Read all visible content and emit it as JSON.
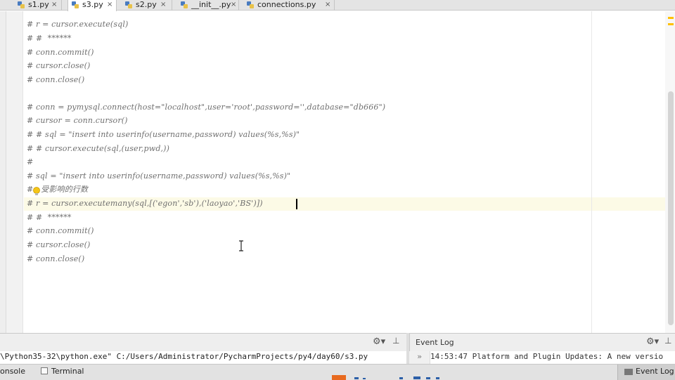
{
  "tabs": [
    {
      "label": "s1.py",
      "active": false
    },
    {
      "label": "s3.py",
      "active": true
    },
    {
      "label": "s2.py",
      "active": false
    },
    {
      "label": "__init__.py",
      "active": false
    },
    {
      "label": "connections.py",
      "active": false
    }
  ],
  "tab_close_glyph": "×",
  "code_lines": [
    "# r = cursor.execute(sql)",
    "# #  ******",
    "# conn.commit()",
    "# cursor.close()",
    "# conn.close()",
    "",
    "# conn = pymysql.connect(host=\"localhost\",user='root',password='',database=\"db666\")",
    "# cursor = conn.cursor()",
    "# # sql = \"insert into userinfo(username,password) values(%s,%s)\"",
    "# # cursor.execute(sql,(user,pwd,))",
    "#",
    "# sql = \"insert into userinfo(username,password) values(%s,%s)\"",
    "#   受影响的行数",
    "# r = cursor.executemany(sql,[('egon','sb'),('laoyao','BS')])",
    "# #  ******",
    "# conn.commit()",
    "# cursor.close()",
    "# conn.close()"
  ],
  "run_panel": {
    "command": "\\Python35-32\\python.exe\" C:/Users/Administrator/PycharmProjects/py4/day60/s3.py",
    "gear": "⚙▾",
    "pin": "⊥"
  },
  "event_log": {
    "title": "Event Log",
    "gutter_glyph": "»",
    "entry": "14:53:47 Platform and Plugin Updates: A new versio",
    "gear": "⚙▾",
    "pin": "⊥"
  },
  "bottom_tabs": {
    "console": "onsole",
    "terminal": "Terminal",
    "event_log": "Event Log"
  },
  "colors": {
    "comment": "#6f6f6f",
    "caret_line": "#fcfae6",
    "python_icon": "#5a8fd0"
  }
}
